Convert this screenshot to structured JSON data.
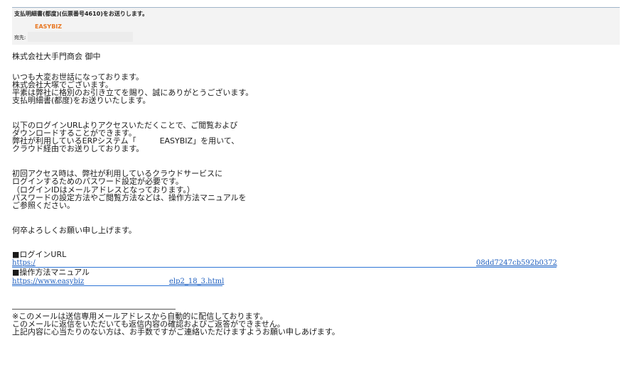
{
  "header": {
    "subject": "支払明細書(都度)(伝票番号4610)をお送りします。",
    "sender": "EASYBIZ",
    "to_label": "宛先:"
  },
  "body": {
    "salutation": "株式会社大手門商会 御中",
    "intro": [
      "いつも大変お世話になっております。",
      "株式会社大塚でございます。",
      "平素は弊社に格別のお引き立てを賜り、誠にありがとうございます。",
      "支払明細書(都度)をお送りいたします。"
    ],
    "access": [
      "以下のログインURLよりアクセスいただくことで、ご閲覧および",
      "ダウンロードすることができます。",
      "弊社が利用しているERPシステム「　　　EASYBIZ」を用いて、",
      "クラウド経由でお送りしております。"
    ],
    "first_access": [
      "初回アクセス時は、弊社が利用しているクラウドサービスに",
      "ログインするためのパスワード設定が必要です。",
      "（ログインIDはメールアドレスとなっております。）",
      "パスワードの設定方法やご閲覧方法などは、操作方法マニュアルを",
      "ご参照ください。"
    ],
    "closing": "何卒よろしくお願い申し上げます。",
    "login_heading": "■ログインURL",
    "login_url_start": "https:/",
    "login_url_end": "08dd7247cb592b0372",
    "manual_heading": "■操作方法マニュアル",
    "manual_url_start": "https://www.easybiz",
    "manual_url_end": "elp2_18_3.html",
    "footer": [
      "※このメールは送信専用メールアドレスから自動的に配信しております。",
      "このメールに返信をいただいても返信内容の確認およびご返答ができません。",
      "上記内容に心当たりのない方は、お手数ですがご連絡いただけますようお願い申しあげます。"
    ]
  }
}
